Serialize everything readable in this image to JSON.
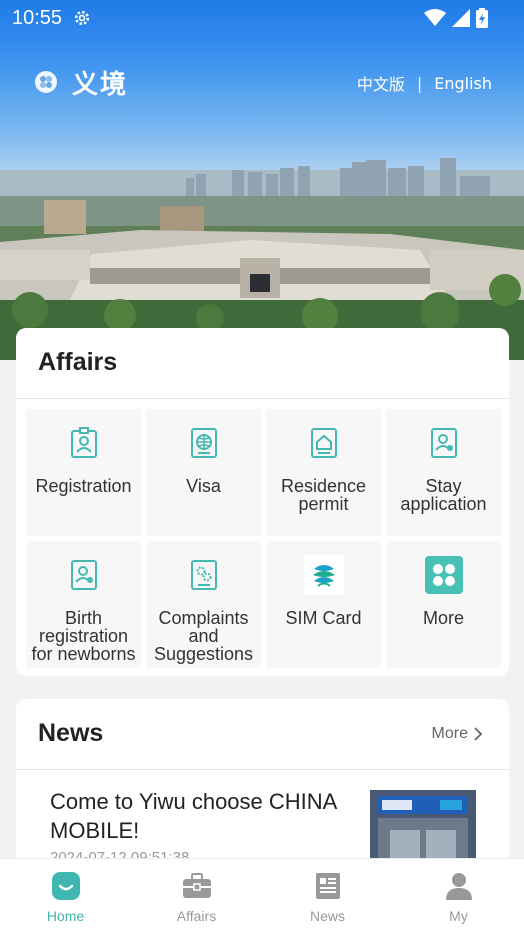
{
  "status_bar": {
    "time": "10:55"
  },
  "header": {
    "brand": "义境",
    "lang_cn": "中文版",
    "separator": "|",
    "lang_en": "English"
  },
  "affairs": {
    "title": "Affairs",
    "items": [
      {
        "label": "Registration",
        "icon": "id-badge-icon"
      },
      {
        "label": "Visa",
        "icon": "globe-icon"
      },
      {
        "label": "Residence permit",
        "icon": "home-card-icon"
      },
      {
        "label": "Stay application",
        "icon": "person-card-icon"
      },
      {
        "label": "Birth registration for newborns",
        "icon": "person-card-icon"
      },
      {
        "label": "Complaints and Suggestions",
        "icon": "cogs-card-icon"
      },
      {
        "label": "SIM Card",
        "icon": "china-mobile-logo"
      },
      {
        "label": "More",
        "icon": "grid-more-icon"
      }
    ]
  },
  "news": {
    "title": "News",
    "more": "More",
    "item": {
      "title": "Come to Yiwu choose CHINA MOBILE!",
      "date": "2024-07-12 09:51:38"
    }
  },
  "bottom_nav": [
    {
      "label": "Home",
      "icon": "home-icon",
      "active": true
    },
    {
      "label": "Affairs",
      "icon": "briefcase-icon",
      "active": false
    },
    {
      "label": "News",
      "icon": "newspaper-icon",
      "active": false
    },
    {
      "label": "My",
      "icon": "user-icon",
      "active": false
    }
  ],
  "colors": {
    "accent": "#3fb6b0",
    "icon_teal": "#46b8b2",
    "sky_top": "#1f7ae8"
  }
}
